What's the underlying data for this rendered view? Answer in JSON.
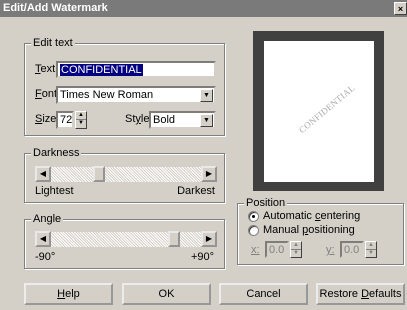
{
  "window": {
    "title": "Edit/Add Watermark",
    "close_icon": "x-icon"
  },
  "edit_text": {
    "legend": "Edit text",
    "text_label_prefix": "T",
    "text_label_rest": "ext:",
    "text_value": "CONFIDENTIAL",
    "font_label_prefix": "F",
    "font_label_rest": "ont:",
    "font_value": "Times New Roman",
    "size_label_prefix": "S",
    "size_label_rest": "ize:",
    "size_value": "72",
    "style_label_pre": "St",
    "style_label_u": "y",
    "style_label_post": "le:",
    "style_value": "Bold"
  },
  "darkness": {
    "legend": "Darkness",
    "min_label": "Lightest",
    "max_label": "Darkest",
    "level_percent": 40
  },
  "angle": {
    "legend": "Angle",
    "min_label": "-90°",
    "max_label": "+90°",
    "value_degrees": 45
  },
  "preview": {
    "watermark_text": "CONFIDENTIAL"
  },
  "position": {
    "legend": "Position",
    "auto_pre": "Automatic ",
    "auto_u": "c",
    "auto_post": "entering",
    "manual_pre": "Manual ",
    "manual_u": "p",
    "manual_post": "ositioning",
    "x_label": "x:",
    "x_value": "0.0",
    "y_label": "y:",
    "y_value": "0.0",
    "selected": "automatic"
  },
  "buttons": {
    "help_u": "H",
    "help_rest": "elp",
    "ok": "OK",
    "cancel": "Cancel",
    "restore_pre": "Restore ",
    "restore_u": "D",
    "restore_post": "efaults"
  }
}
